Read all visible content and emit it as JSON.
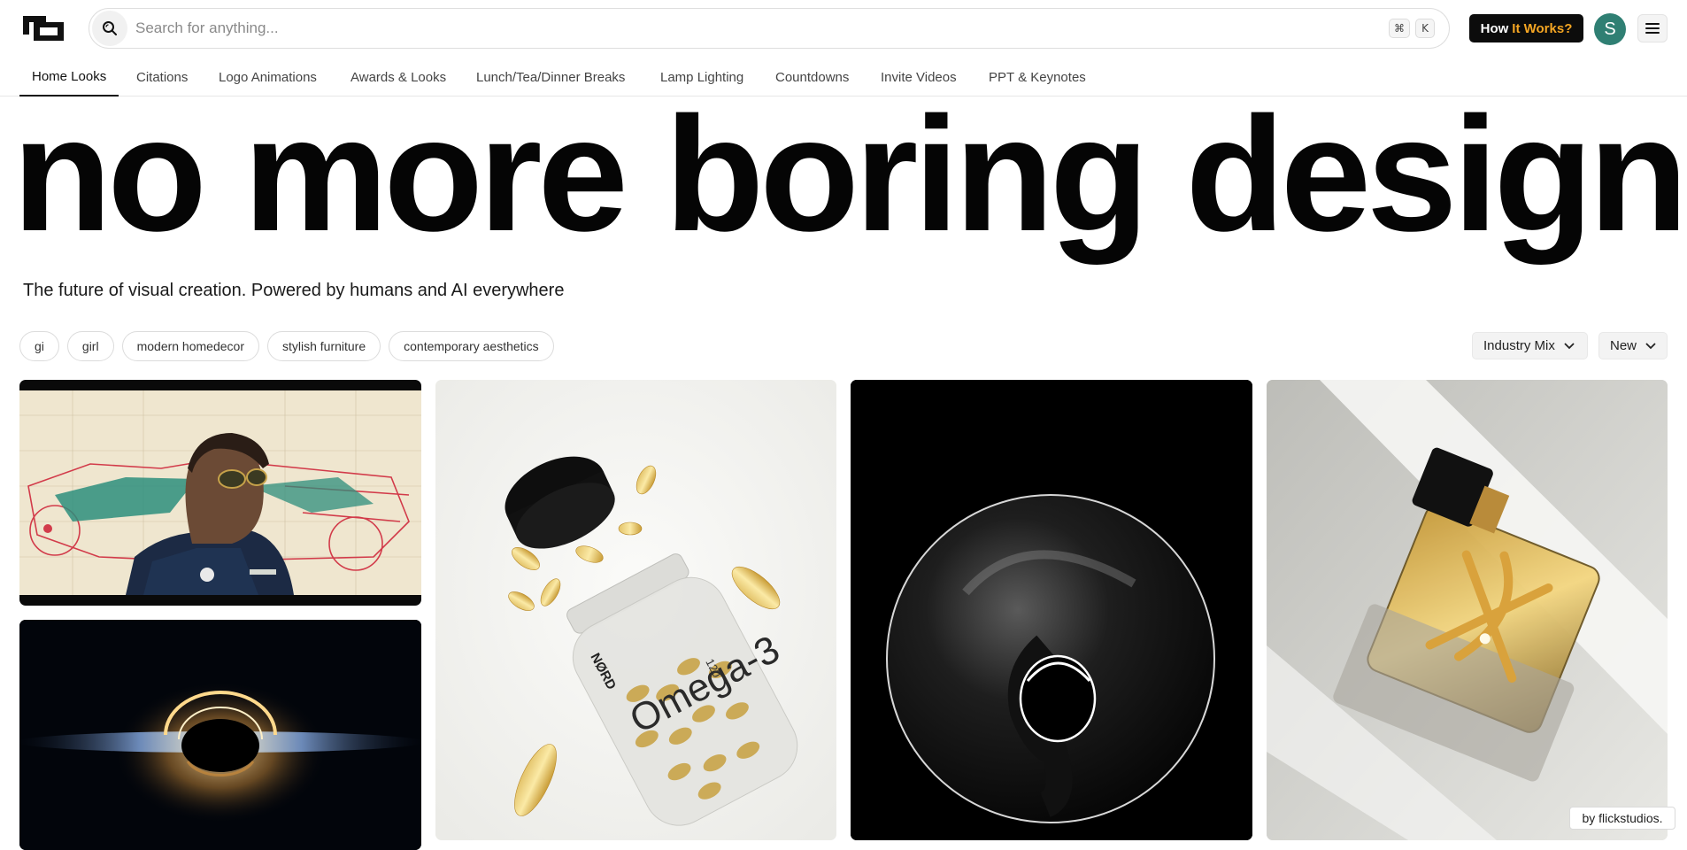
{
  "header": {
    "logo_icon": "brand-logo-icon",
    "search": {
      "icon": "search-icon",
      "placeholder": "Search for anything...",
      "value": "",
      "shortcut_keys": [
        "⌘",
        "K"
      ]
    },
    "how_button": {
      "label_part1": "How",
      "label_part2": "It Works?",
      "accent_color": "#f5a623"
    },
    "avatar": {
      "initial": "S",
      "color": "#2f7f73"
    },
    "menu_icon": "hamburger-menu-icon"
  },
  "nav": {
    "tabs": [
      {
        "label": "Home Looks",
        "active": true
      },
      {
        "label": "Citations",
        "active": false
      },
      {
        "label": "Logo Animations",
        "active": false
      },
      {
        "label": "Awards & Looks",
        "active": false
      },
      {
        "label": "Lunch/Tea/Dinner Breaks",
        "active": false
      },
      {
        "label": "Lamp Lighting",
        "active": false
      },
      {
        "label": "Countdowns",
        "active": false
      },
      {
        "label": "Invite Videos",
        "active": false
      },
      {
        "label": "PPT & Keynotes",
        "active": false
      }
    ]
  },
  "hero": {
    "title": "no more boring design",
    "subtitle": "The future of visual creation. Powered by humans and AI everywhere"
  },
  "filters": {
    "chips": [
      "gi",
      "girl",
      "modern homedecor",
      "stylish furniture",
      "contemporary aesthetics"
    ],
    "industry_dropdown": "Industry Mix",
    "sort_dropdown": "New"
  },
  "gallery": {
    "items": [
      {
        "name": "racing-driver-blueprint-card"
      },
      {
        "name": "black-hole-card"
      },
      {
        "name": "omega-3-bottle-card",
        "bottle_brand": "NØRD",
        "bottle_label": "Omega-3",
        "bottle_count": "120"
      },
      {
        "name": "chrome-torus-card"
      },
      {
        "name": "perfume-bottle-card"
      }
    ],
    "credit": "by flickstudios."
  }
}
